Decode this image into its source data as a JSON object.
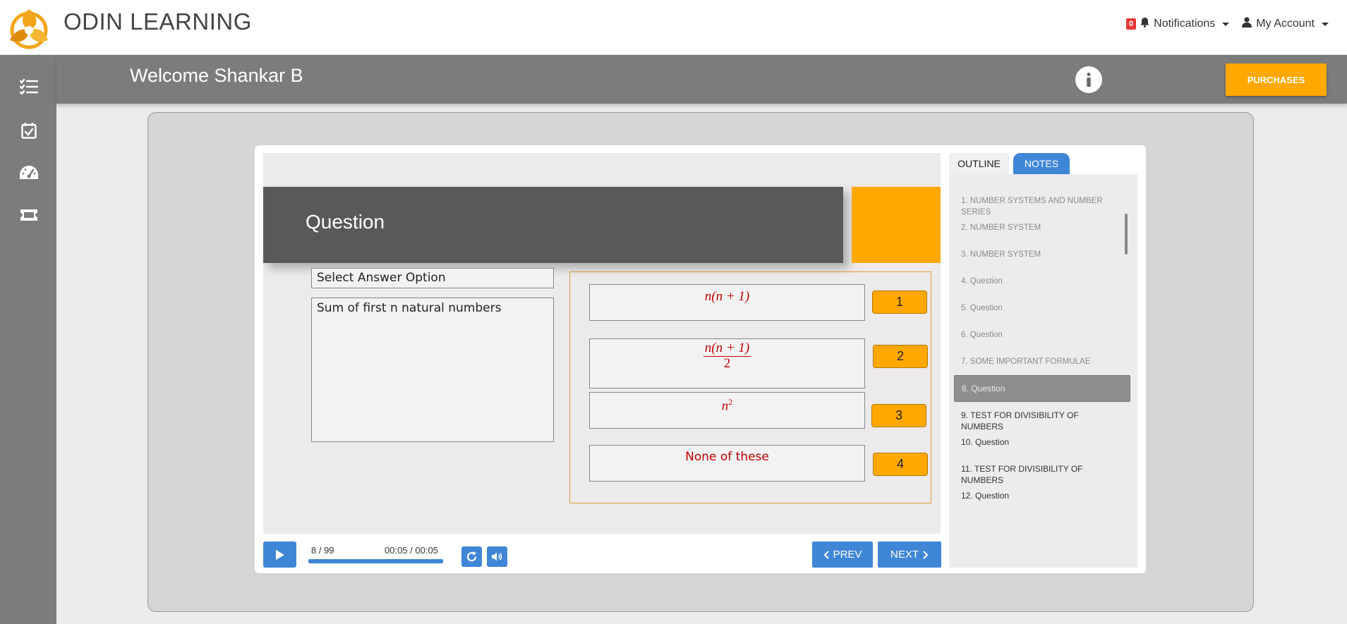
{
  "app": {
    "title": "ODIN LEARNING"
  },
  "header": {
    "notifications": {
      "count": "0",
      "label": "Notifications"
    },
    "account": {
      "label": "My Account"
    }
  },
  "sidebar": {
    "items": [
      {
        "icon": "list-check-icon"
      },
      {
        "icon": "calendar-check-icon"
      },
      {
        "icon": "speedometer-icon"
      },
      {
        "icon": "ticket-icon"
      }
    ]
  },
  "welcome": {
    "text": "Welcome Shankar B",
    "purchases_label": "PURCHASES"
  },
  "slide": {
    "title": "Question",
    "select_label": "Select Answer Option",
    "question_text": "Sum of first n natural numbers",
    "options": [
      {
        "text": "n(n + 1)",
        "number": "1"
      },
      {
        "numerator": "n(n + 1)",
        "denominator": "2",
        "number": "2"
      },
      {
        "base": "n",
        "exponent": "2",
        "number": "3"
      },
      {
        "text": "None of these",
        "number": "4"
      }
    ]
  },
  "controls": {
    "slide_count": "8 / 99",
    "time": "00:05 / 00:05",
    "progress": 1.0,
    "prev_label": "PREV",
    "next_label": "NEXT"
  },
  "outline": {
    "tabs": {
      "outline": "OUTLINE",
      "notes": "NOTES"
    },
    "items": [
      "1. NUMBER SYSTEMS AND NUMBER SERIES",
      "2. NUMBER SYSTEM",
      "3. NUMBER SYSTEM",
      "4. Question",
      "5. Question",
      "6. Question",
      "7. SOME IMPORTANT FORMULAE",
      "8. Question",
      "9. TEST FOR DIVISIBILITY OF NUMBERS",
      "10. Question",
      "11. TEST FOR DIVISIBILITY OF NUMBERS",
      "12. Question"
    ],
    "active_index": 7
  },
  "colors": {
    "accent": "#3f86d6",
    "orange": "#fea800",
    "sidebar": "#7c7c7c",
    "option_text": "#c00000"
  }
}
